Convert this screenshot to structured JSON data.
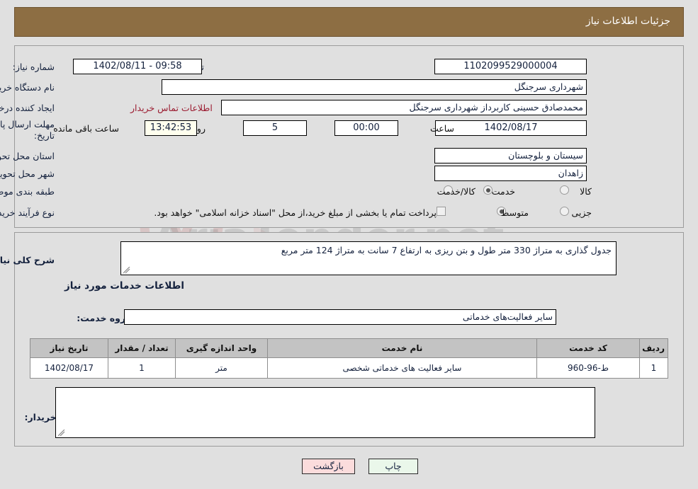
{
  "header": {
    "title": "جزئیات اطلاعات نیاز",
    "bar_color": "#8d6e43"
  },
  "watermark": {
    "text": "AriaTender.net"
  },
  "form": {
    "need_number_label": "شماره نیاز:",
    "need_number_value": "1102099529000004",
    "public_notice_label": "تاریخ و ساعت اعلان عمومی:",
    "public_notice_value": "1402/08/11 - 09:58",
    "buyer_org_label": "نام دستگاه خریدار:",
    "buyer_org_value": "شهرداری سرجنگل",
    "creator_label": "ایجاد کننده درخواست:",
    "creator_value": "محمدصادق حسینی کاربرداز شهرداری سرجنگل",
    "buyer_contact_link": "اطلاعات تماس خریدار",
    "deadline_label_line1": "مهلت ارسال پاسخ: تا",
    "deadline_label_line2": "تاریخ:",
    "deadline_date": "1402/08/17",
    "deadline_hour_label": "ساعت",
    "deadline_hour_value": "00:00",
    "remaining_days": "5",
    "remaining_days_suffix": "روز و",
    "remaining_time": "13:42:53",
    "remaining_time_suffix": "ساعت باقی مانده",
    "province_label": "استان محل تحویل:",
    "province_value": "سیستان و بلوچستان",
    "city_label": "شهر محل تحویل:",
    "city_value": "زاهدان",
    "category_label": "طبقه بندی موضوعی:",
    "category_options": [
      {
        "label": "کالا",
        "selected": false
      },
      {
        "label": "خدمت",
        "selected": true
      },
      {
        "label": "کالا/خدمت",
        "selected": false
      }
    ],
    "process_label": "نوع فرآیند خرید :",
    "process_options": [
      {
        "label": "جزیی",
        "selected": false
      },
      {
        "label": "متوسط",
        "selected": true
      }
    ],
    "treasury_checkbox_label": "پرداخت تمام یا بخشی از مبلغ خرید،از محل \"اسناد خزانه اسلامی\" خواهد بود.",
    "treasury_checked": false
  },
  "description": {
    "general_need_label": "شرح کلی نیاز:",
    "general_need_value": "جدول گذاری به متراژ 330 متر طول و بتن ریزی به ارتفاع 7 سانت به متراژ 124 متر مربع"
  },
  "services": {
    "section_title": "اطلاعات خدمات مورد نیاز",
    "group_label": "گروه خدمت:",
    "group_value": "سایر فعالیت‌های خدماتی",
    "table": {
      "columns": [
        "ردیف",
        "کد خدمت",
        "نام خدمت",
        "واحد اندازه گیری",
        "تعداد / مقدار",
        "تاریخ نیاز"
      ],
      "rows": [
        {
          "row_no": "1",
          "service_code": "ط-96-960",
          "service_name": "سایر فعالیت های خدماتی شخصی",
          "unit": "متر",
          "quantity": "1",
          "need_date": "1402/08/17"
        }
      ]
    }
  },
  "buyer_notes": {
    "label": "توضیحات خریدار:",
    "value": ""
  },
  "buttons": {
    "print": "چاپ",
    "back": "بازگشت"
  }
}
